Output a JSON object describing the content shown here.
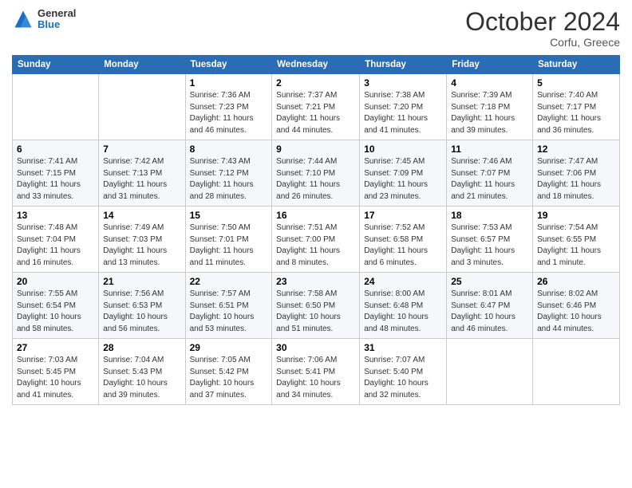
{
  "header": {
    "logo_general": "General",
    "logo_blue": "Blue",
    "month_title": "October 2024",
    "location": "Corfu, Greece"
  },
  "days_of_week": [
    "Sunday",
    "Monday",
    "Tuesday",
    "Wednesday",
    "Thursday",
    "Friday",
    "Saturday"
  ],
  "weeks": [
    [
      {
        "day": "",
        "info": ""
      },
      {
        "day": "",
        "info": ""
      },
      {
        "day": "1",
        "info": "Sunrise: 7:36 AM\nSunset: 7:23 PM\nDaylight: 11 hours and 46 minutes."
      },
      {
        "day": "2",
        "info": "Sunrise: 7:37 AM\nSunset: 7:21 PM\nDaylight: 11 hours and 44 minutes."
      },
      {
        "day": "3",
        "info": "Sunrise: 7:38 AM\nSunset: 7:20 PM\nDaylight: 11 hours and 41 minutes."
      },
      {
        "day": "4",
        "info": "Sunrise: 7:39 AM\nSunset: 7:18 PM\nDaylight: 11 hours and 39 minutes."
      },
      {
        "day": "5",
        "info": "Sunrise: 7:40 AM\nSunset: 7:17 PM\nDaylight: 11 hours and 36 minutes."
      }
    ],
    [
      {
        "day": "6",
        "info": "Sunrise: 7:41 AM\nSunset: 7:15 PM\nDaylight: 11 hours and 33 minutes."
      },
      {
        "day": "7",
        "info": "Sunrise: 7:42 AM\nSunset: 7:13 PM\nDaylight: 11 hours and 31 minutes."
      },
      {
        "day": "8",
        "info": "Sunrise: 7:43 AM\nSunset: 7:12 PM\nDaylight: 11 hours and 28 minutes."
      },
      {
        "day": "9",
        "info": "Sunrise: 7:44 AM\nSunset: 7:10 PM\nDaylight: 11 hours and 26 minutes."
      },
      {
        "day": "10",
        "info": "Sunrise: 7:45 AM\nSunset: 7:09 PM\nDaylight: 11 hours and 23 minutes."
      },
      {
        "day": "11",
        "info": "Sunrise: 7:46 AM\nSunset: 7:07 PM\nDaylight: 11 hours and 21 minutes."
      },
      {
        "day": "12",
        "info": "Sunrise: 7:47 AM\nSunset: 7:06 PM\nDaylight: 11 hours and 18 minutes."
      }
    ],
    [
      {
        "day": "13",
        "info": "Sunrise: 7:48 AM\nSunset: 7:04 PM\nDaylight: 11 hours and 16 minutes."
      },
      {
        "day": "14",
        "info": "Sunrise: 7:49 AM\nSunset: 7:03 PM\nDaylight: 11 hours and 13 minutes."
      },
      {
        "day": "15",
        "info": "Sunrise: 7:50 AM\nSunset: 7:01 PM\nDaylight: 11 hours and 11 minutes."
      },
      {
        "day": "16",
        "info": "Sunrise: 7:51 AM\nSunset: 7:00 PM\nDaylight: 11 hours and 8 minutes."
      },
      {
        "day": "17",
        "info": "Sunrise: 7:52 AM\nSunset: 6:58 PM\nDaylight: 11 hours and 6 minutes."
      },
      {
        "day": "18",
        "info": "Sunrise: 7:53 AM\nSunset: 6:57 PM\nDaylight: 11 hours and 3 minutes."
      },
      {
        "day": "19",
        "info": "Sunrise: 7:54 AM\nSunset: 6:55 PM\nDaylight: 11 hours and 1 minute."
      }
    ],
    [
      {
        "day": "20",
        "info": "Sunrise: 7:55 AM\nSunset: 6:54 PM\nDaylight: 10 hours and 58 minutes."
      },
      {
        "day": "21",
        "info": "Sunrise: 7:56 AM\nSunset: 6:53 PM\nDaylight: 10 hours and 56 minutes."
      },
      {
        "day": "22",
        "info": "Sunrise: 7:57 AM\nSunset: 6:51 PM\nDaylight: 10 hours and 53 minutes."
      },
      {
        "day": "23",
        "info": "Sunrise: 7:58 AM\nSunset: 6:50 PM\nDaylight: 10 hours and 51 minutes."
      },
      {
        "day": "24",
        "info": "Sunrise: 8:00 AM\nSunset: 6:48 PM\nDaylight: 10 hours and 48 minutes."
      },
      {
        "day": "25",
        "info": "Sunrise: 8:01 AM\nSunset: 6:47 PM\nDaylight: 10 hours and 46 minutes."
      },
      {
        "day": "26",
        "info": "Sunrise: 8:02 AM\nSunset: 6:46 PM\nDaylight: 10 hours and 44 minutes."
      }
    ],
    [
      {
        "day": "27",
        "info": "Sunrise: 7:03 AM\nSunset: 5:45 PM\nDaylight: 10 hours and 41 minutes."
      },
      {
        "day": "28",
        "info": "Sunrise: 7:04 AM\nSunset: 5:43 PM\nDaylight: 10 hours and 39 minutes."
      },
      {
        "day": "29",
        "info": "Sunrise: 7:05 AM\nSunset: 5:42 PM\nDaylight: 10 hours and 37 minutes."
      },
      {
        "day": "30",
        "info": "Sunrise: 7:06 AM\nSunset: 5:41 PM\nDaylight: 10 hours and 34 minutes."
      },
      {
        "day": "31",
        "info": "Sunrise: 7:07 AM\nSunset: 5:40 PM\nDaylight: 10 hours and 32 minutes."
      },
      {
        "day": "",
        "info": ""
      },
      {
        "day": "",
        "info": ""
      }
    ]
  ]
}
